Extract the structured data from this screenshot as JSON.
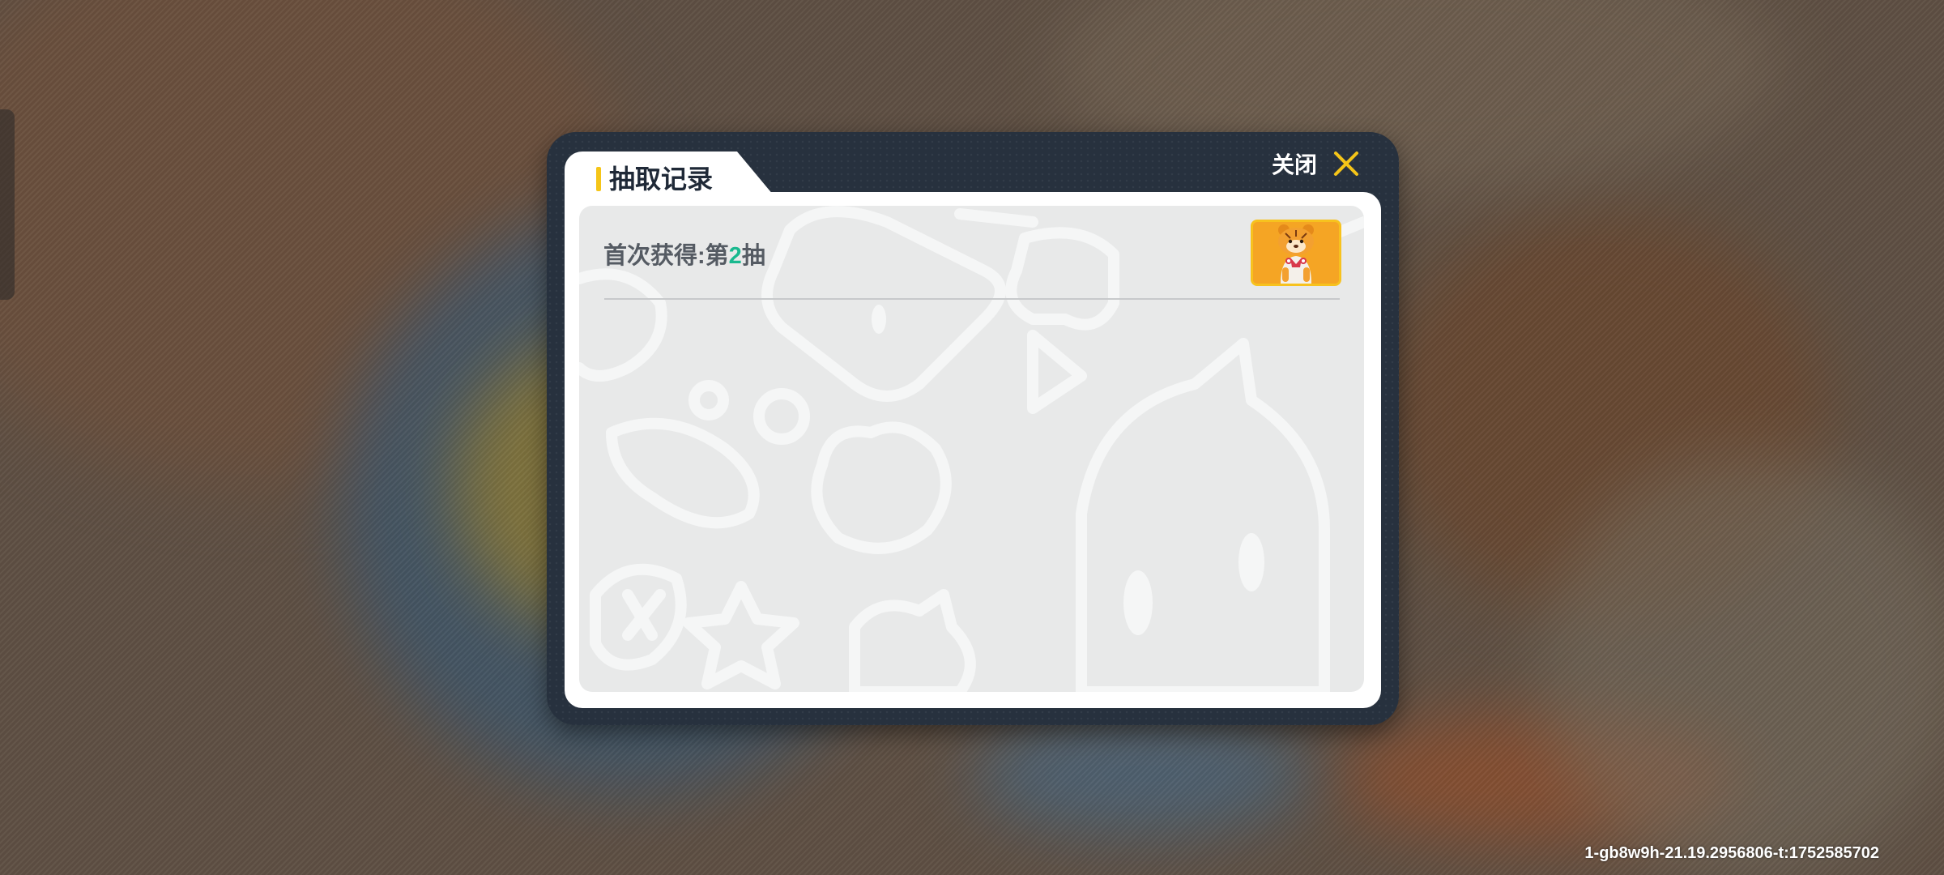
{
  "dialog": {
    "title": "抽取记录",
    "close_label": "关闭"
  },
  "record": {
    "prefix": "首次获得:第",
    "number": "2",
    "suffix": "抽",
    "reward_icon": "tiger-character-icon"
  },
  "footer": {
    "debug_id": "1-gb8w9h-21.19.2956806-t:1752585702"
  },
  "colors": {
    "accent": "#f5c518",
    "highlight_number": "#19b98f",
    "dialog_frame": "#27313e"
  }
}
